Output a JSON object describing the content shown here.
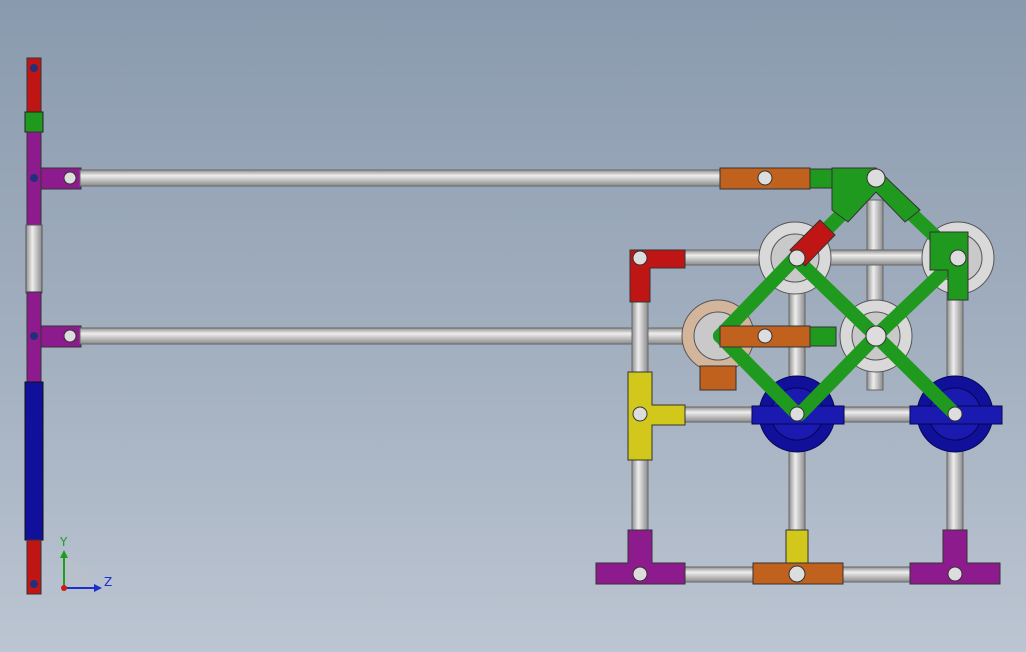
{
  "view": {
    "background_top": "#8a9aae",
    "background_bottom": "#bcc5d2"
  },
  "triad": {
    "y_label": "Y",
    "z_label": "Z",
    "y_color": "#1aa01a",
    "z_color": "#1a2fd0",
    "x_color": "#d01a1a"
  },
  "palette": {
    "rod": "#c8c8c8",
    "purple": "#8e1b8e",
    "red": "#c01515",
    "green": "#1f9a1f",
    "blue": "#10109a",
    "orange": "#c0621e",
    "yellow": "#d2c81c",
    "white": "#d9d9d9"
  }
}
